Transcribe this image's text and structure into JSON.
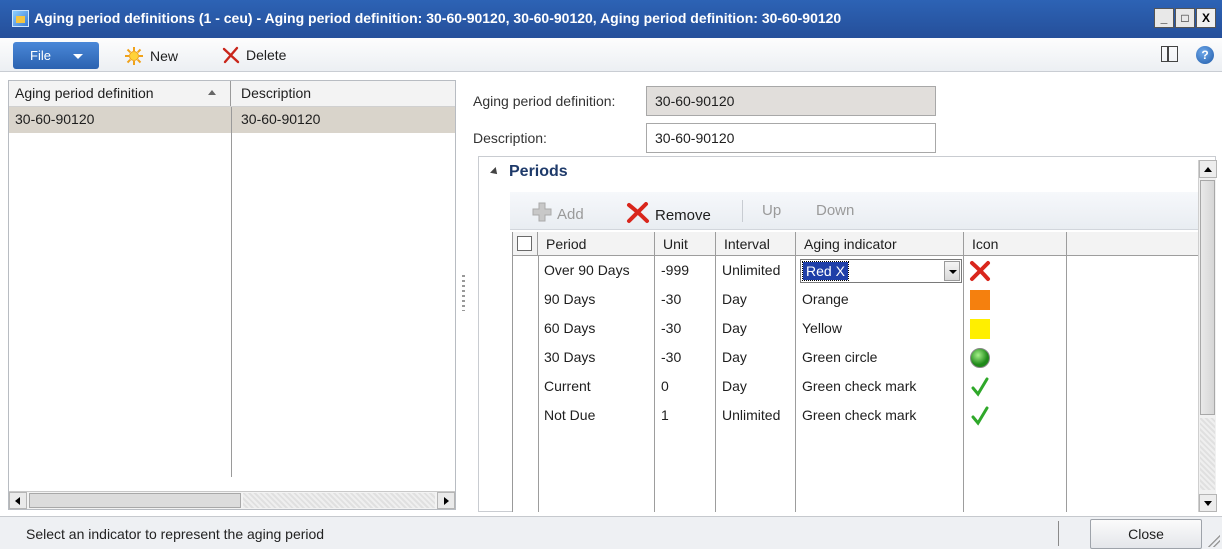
{
  "window": {
    "title": "Aging period definitions (1 - ceu) - Aging period definition: 30-60-90120, 30-60-90120, Aging period definition: 30-60-90120",
    "buttons": {
      "minimize": "_",
      "maximize": "□",
      "close": "X"
    }
  },
  "toolbar": {
    "file_label": "File",
    "new_label": "New",
    "delete_label": "Delete"
  },
  "list": {
    "columns": [
      "Aging period definition",
      "Description"
    ],
    "rows": [
      {
        "definition": "30-60-90120",
        "description": "30-60-90120"
      }
    ]
  },
  "form": {
    "definition_label": "Aging period definition:",
    "definition_value": "30-60-90120",
    "description_label": "Description:",
    "description_value": "30-60-90120"
  },
  "periods": {
    "group_title": "Periods",
    "actions": {
      "add": "Add",
      "remove": "Remove",
      "up": "Up",
      "down": "Down"
    },
    "columns": [
      "Period",
      "Unit",
      "Interval",
      "Aging indicator",
      "Icon"
    ],
    "rows": [
      {
        "period": "Over 90 Days",
        "unit": "-999",
        "interval": "Unlimited",
        "indicator": "Red X",
        "icon": "red-x-icon"
      },
      {
        "period": "90 Days",
        "unit": "-30",
        "interval": "Day",
        "indicator": "Orange",
        "icon": "orange-square-icon"
      },
      {
        "period": "60 Days",
        "unit": "-30",
        "interval": "Day",
        "indicator": "Yellow",
        "icon": "yellow-square-icon"
      },
      {
        "period": "30 Days",
        "unit": "-30",
        "interval": "Day",
        "indicator": "Green circle",
        "icon": "green-circle-icon"
      },
      {
        "period": "Current",
        "unit": "0",
        "interval": "Day",
        "indicator": "Green check mark",
        "icon": "green-check-icon"
      },
      {
        "period": "Not Due",
        "unit": "1",
        "interval": "Unlimited",
        "indicator": "Green check mark",
        "icon": "green-check-icon"
      }
    ]
  },
  "status": {
    "message": "Select an indicator to represent the aging period",
    "close_label": "Close"
  },
  "colors": {
    "titlebar": "#2d63b5",
    "selection": "#1f3fa8",
    "orange": "#f5800e",
    "yellow": "#ffef00",
    "green": "#2fa82a",
    "red": "#d9261c"
  }
}
